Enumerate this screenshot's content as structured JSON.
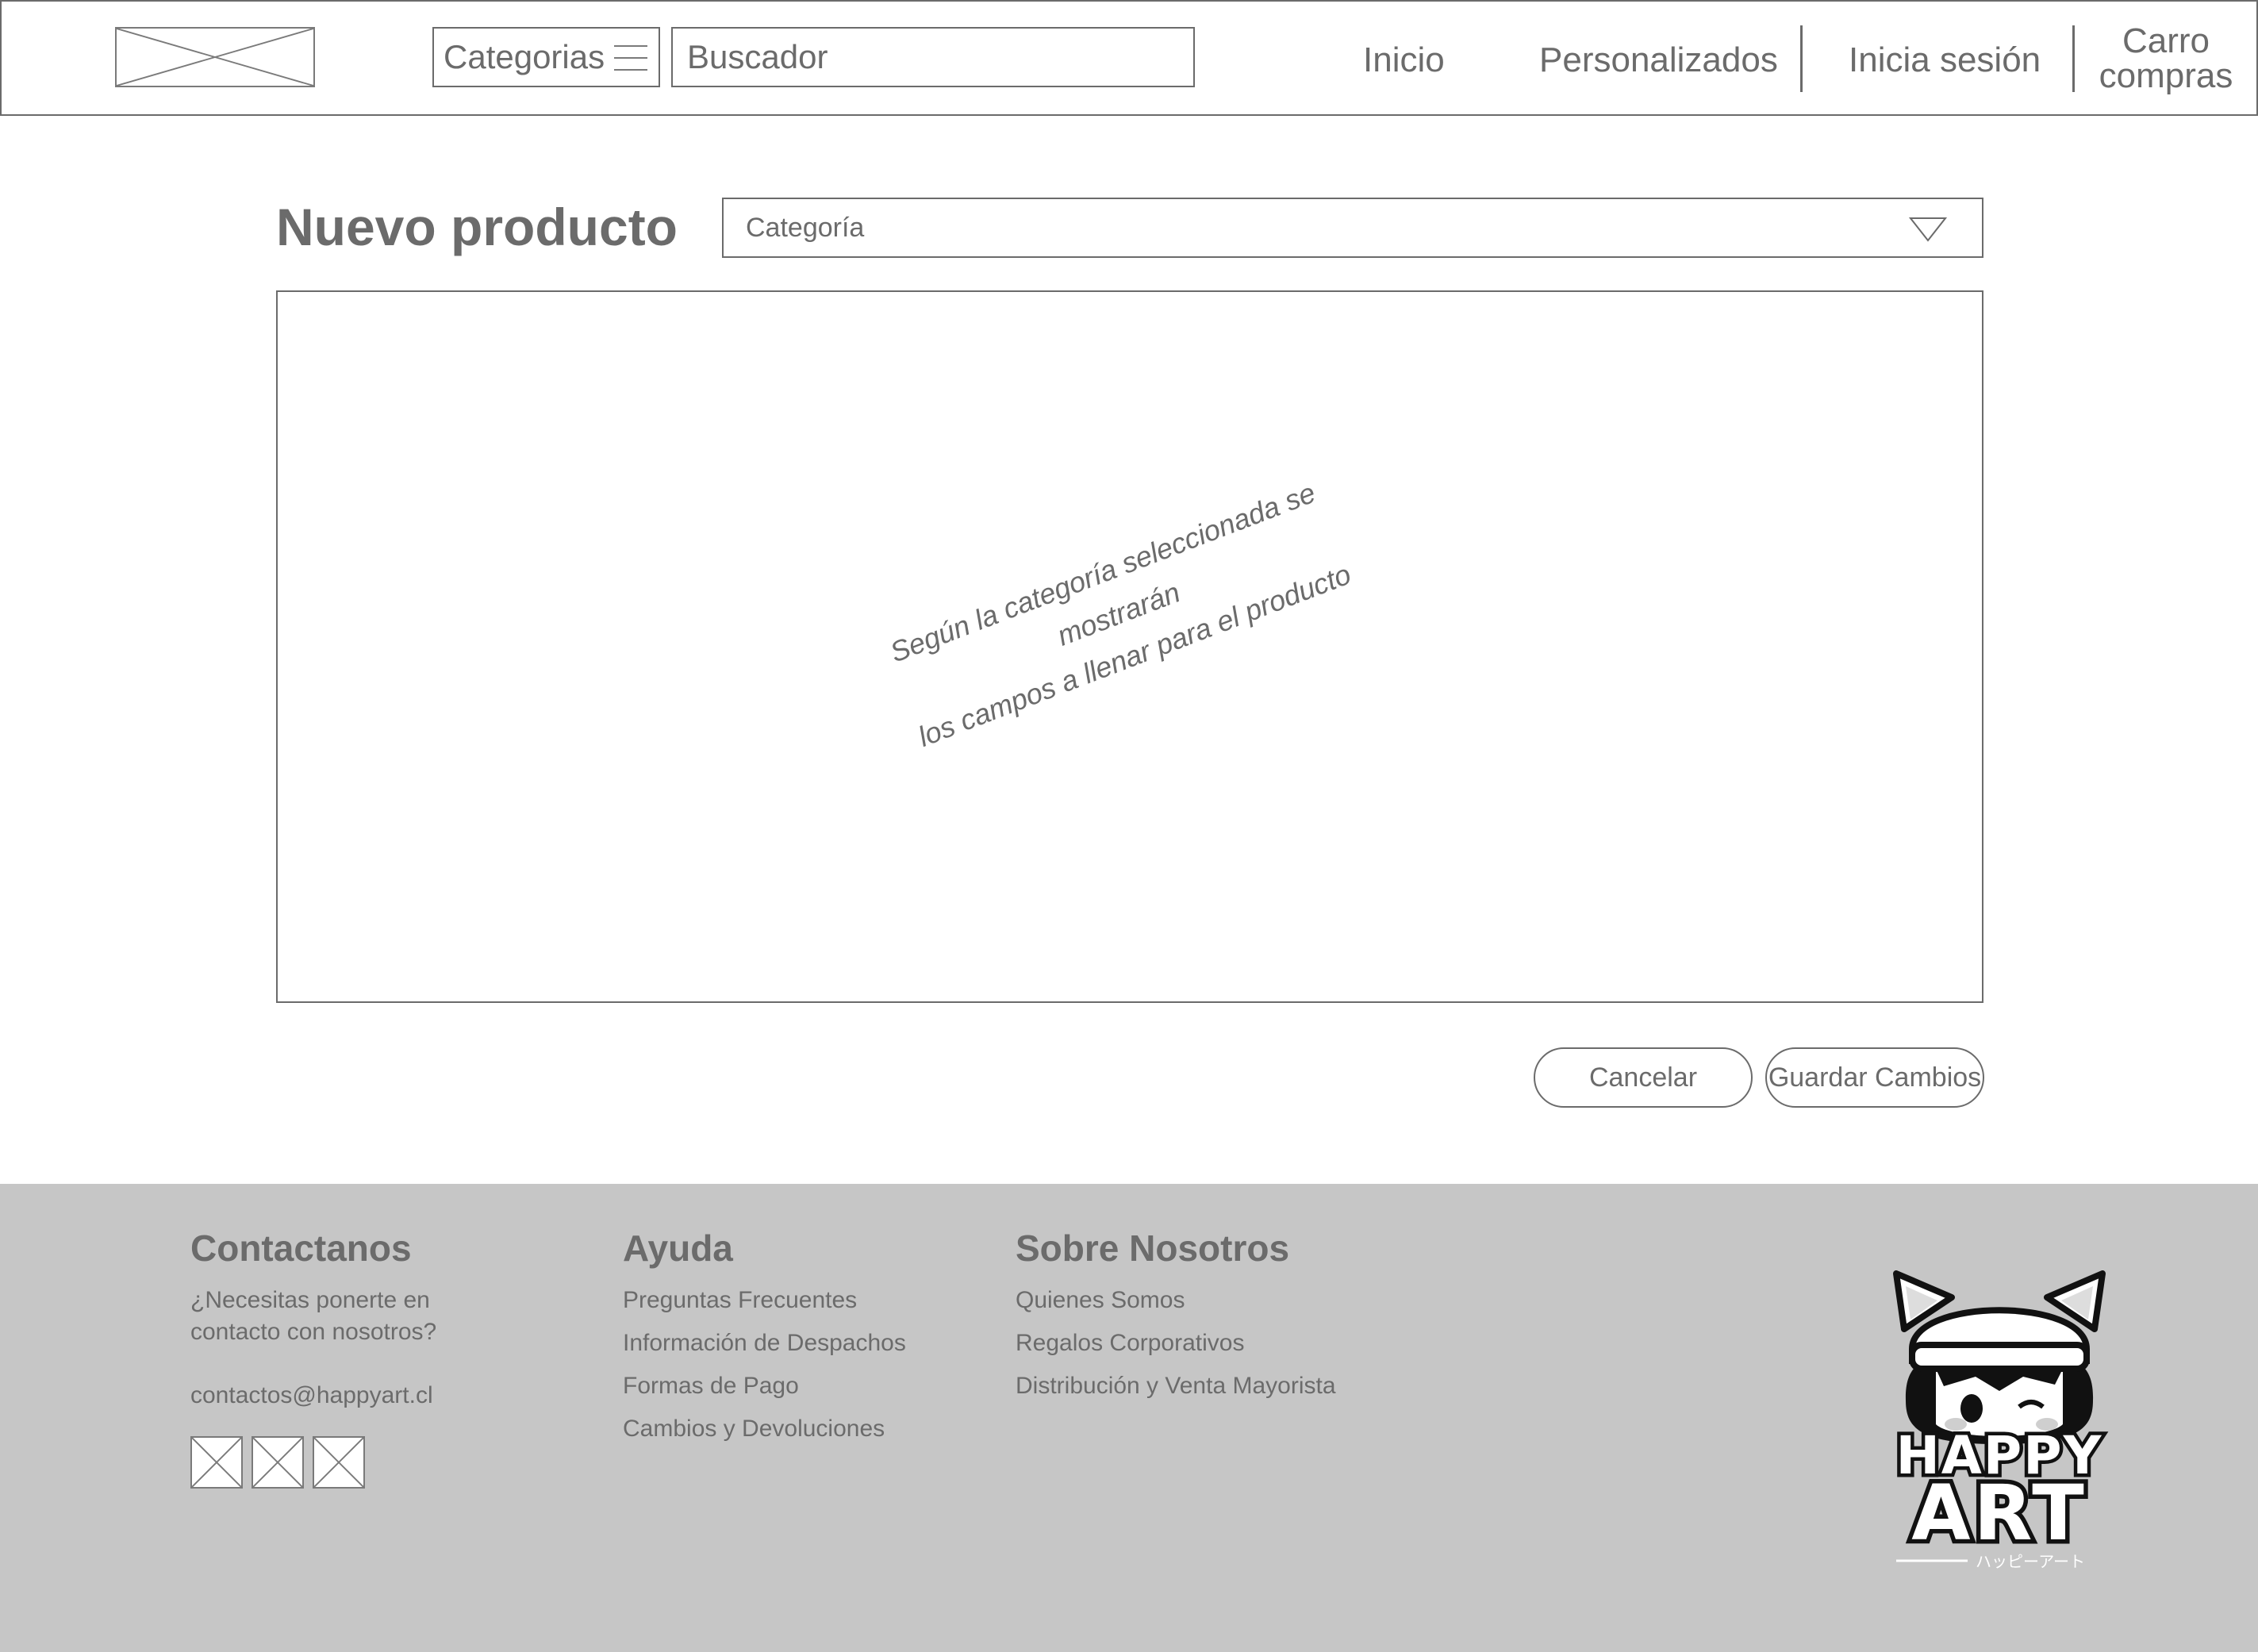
{
  "header": {
    "categories_label": "Categorias",
    "search_placeholder": "Buscador",
    "nav": {
      "home": "Inicio",
      "custom": "Personalizados",
      "login": "Inicia sesión",
      "cart_line1": "Carro",
      "cart_line2": "compras"
    }
  },
  "main": {
    "title": "Nuevo producto",
    "category_select": {
      "placeholder": "Categoría"
    },
    "form_note_line1": "Según la categoría seleccionada se mostrarán",
    "form_note_line2": "los campos a llenar para el producto",
    "buttons": {
      "cancel": "Cancelar",
      "save": "Guardar Cambios"
    }
  },
  "footer": {
    "contact": {
      "title": "Contactanos",
      "question": "¿Necesitas ponerte en contacto con nosotros?",
      "email": "contactos@happyart.cl"
    },
    "help": {
      "title": "Ayuda",
      "items": [
        "Preguntas Frecuentes",
        "Información de Despachos",
        "Formas de Pago",
        "Cambios y Devoluciones"
      ]
    },
    "about": {
      "title": "Sobre Nosotros",
      "items": [
        "Quienes Somos",
        "Regalos Corporativos",
        "Distribución y Venta Mayorista"
      ]
    },
    "brand": {
      "line1": "HAPPY",
      "line2": "ART",
      "subtitle": "ハッピーアート"
    }
  },
  "colors": {
    "wire_gray": "#6b6b6b",
    "footer_bg": "#c6c6c6",
    "page_bg": "#ffffff"
  },
  "icons": {
    "logo_placeholder": "image-placeholder-icon",
    "menu": "hamburger-menu-icon",
    "dropdown": "triangle-down-icon",
    "social": "image-placeholder-icon"
  }
}
